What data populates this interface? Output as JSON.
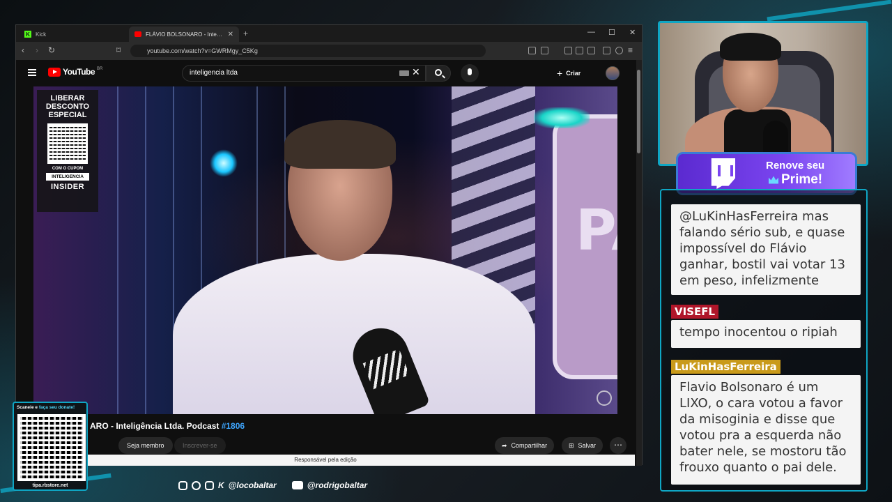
{
  "browser": {
    "tabs": [
      {
        "label": "Kick"
      },
      {
        "label": "FLÁVIO BOLSONARO - Inteligência Ltda. Podcast"
      }
    ],
    "url": "youtube.com/watch?v=GWRMgy_C5Kg"
  },
  "youtube": {
    "logo_text": "YouTube",
    "region": "BR",
    "search_value": "inteligencia ltda",
    "create_label": "Criar",
    "video_title": "ARO - Inteligência Ltda. Podcast ",
    "video_tag": "#1806",
    "member_label": "Seja membro",
    "subscribe_label": "Inscrever-se",
    "share_label": "Compartilhar",
    "save_label": "Salvar",
    "caption_text": "Responsável pela edição"
  },
  "video_overlay": {
    "promo_title": "LIBERAR DESCONTO ESPECIAL",
    "promo_small": "COM O CUPOM",
    "promo_code": "INTELIGENCIA",
    "promo_brand": "INSIDER",
    "sign_text": "PA"
  },
  "donation": {
    "label_prefix": "Scaneie e ",
    "label_highlight": "faça seu donate!",
    "url": "tipa.rbstore.net"
  },
  "socials": {
    "kick_handle": "@locobaltar",
    "youtube_handle": "@rodrigobaltar"
  },
  "prime": {
    "line1": "Renove seu",
    "line2": "Prime!"
  },
  "chat": {
    "messages": [
      {
        "user": "",
        "text": "@LuKinHasFerreira mas falando sério sub, e quase impossível do Flávio ganhar, bostil vai votar 13 em peso, infelizmente"
      },
      {
        "user": "VISEFL",
        "text": "tempo inocentou o ripiah"
      },
      {
        "user": "LuKinHasFerreira",
        "text": "Flavio Bolsonaro é um LIXO, o cara votou a favor da misoginia e disse que votou pra a esquerda não bater nele, se mostoru tão frouxo quanto o pai dele."
      }
    ]
  },
  "colors": {
    "accent": "#0fa6c4",
    "youtube_red": "#ff0000",
    "twitch_purple": "#7b45f0",
    "user_visefl": "#b0162a",
    "user_lukin": "#c99a1a"
  }
}
